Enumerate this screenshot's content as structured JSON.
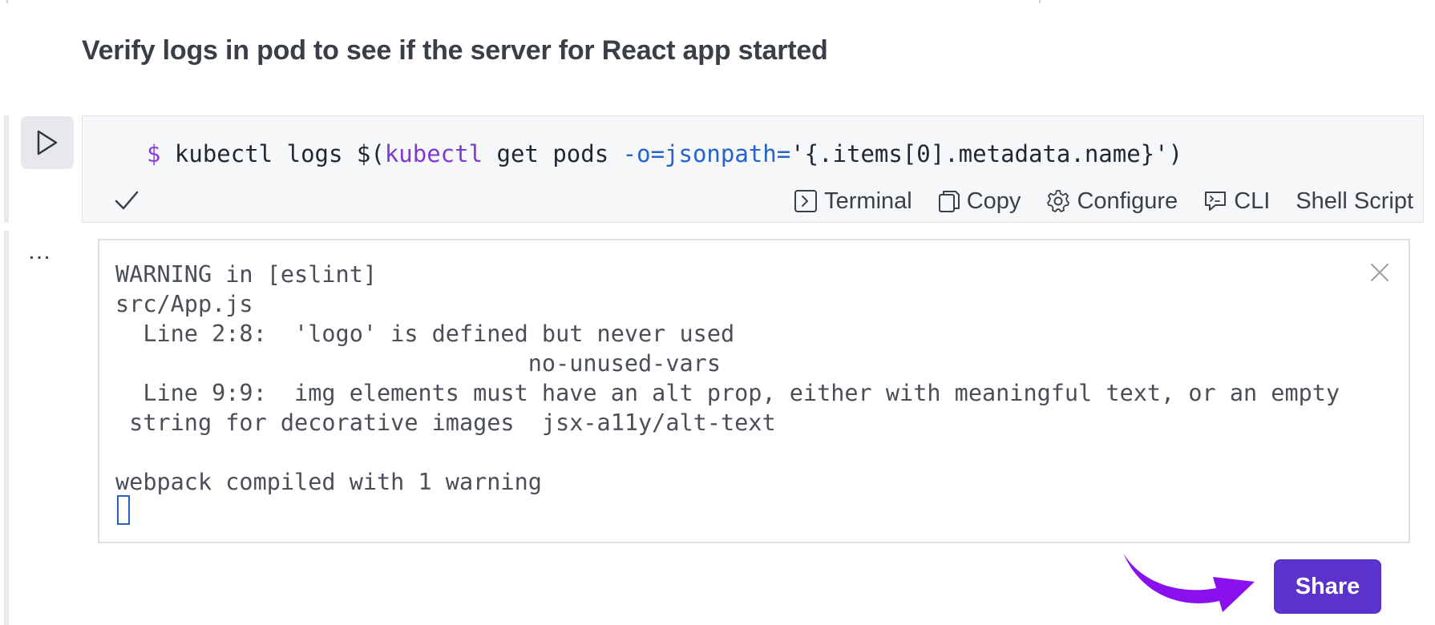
{
  "step": {
    "title": "Verify logs in pod to see if the server for React app started"
  },
  "code": {
    "prompt": "$",
    "cmd_part1": " kubectl logs $(",
    "cmd_sub": "kubectl",
    "cmd_part2": " get pods ",
    "cmd_flag": "-o=jsonpath=",
    "cmd_part3": "'{.items[0].metadata.name}')"
  },
  "toolbar": {
    "terminal_label": "Terminal",
    "copy_label": "Copy",
    "configure_label": "Configure",
    "cli_label": "CLI",
    "shell_script_label": "Shell Script"
  },
  "output": {
    "lines": [
      "WARNING in [eslint]",
      "src/App.js",
      "  Line 2:8:  'logo' is defined but never used",
      "                              no-unused-vars",
      "  Line 9:9:  img elements must have an alt prop, either with meaningful text, or an empty",
      " string for decorative images  jsx-a11y/alt-text",
      "",
      "webpack compiled with 1 warning"
    ]
  },
  "share": {
    "label": "Share"
  },
  "colors": {
    "share_bg": "#5b32cc",
    "arrow": "#8a10f0",
    "prompt": "#8a3fd6",
    "flag": "#2563c9"
  },
  "icons": [
    "play-icon",
    "check-icon",
    "terminal-icon",
    "copy-icon",
    "gear-icon",
    "cli-icon",
    "more-icon",
    "close-icon",
    "arrow-pointer"
  ]
}
